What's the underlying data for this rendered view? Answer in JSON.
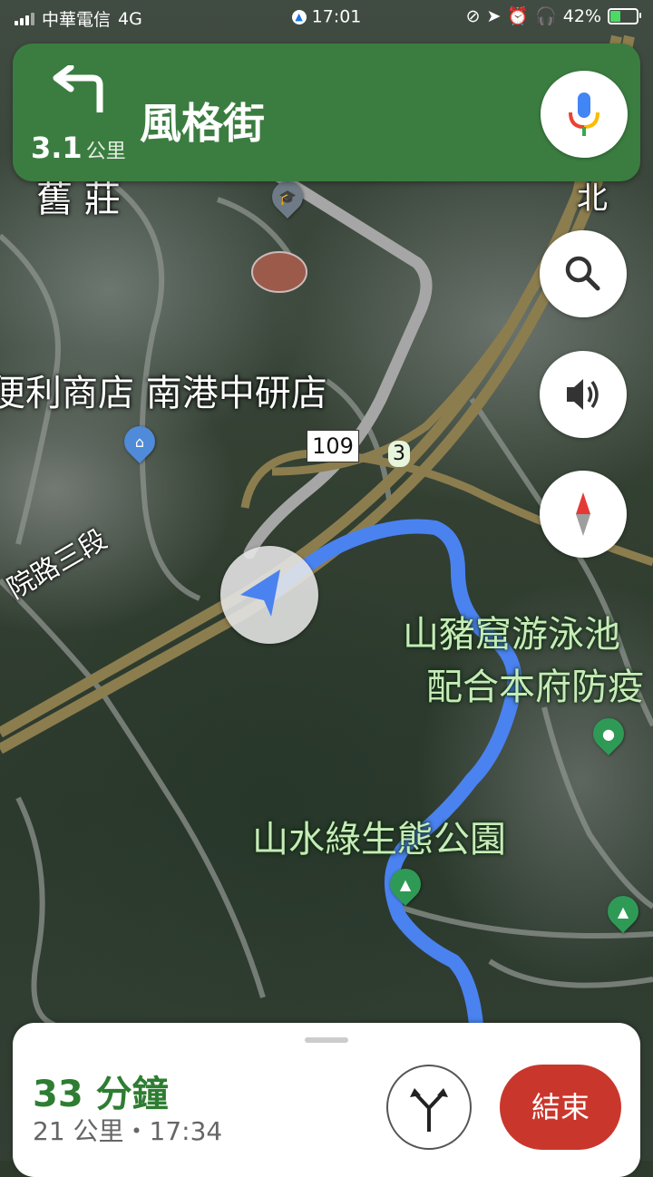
{
  "status_bar": {
    "carrier": "中華電信",
    "network": "4G",
    "time": "17:01",
    "battery_percent": "42%",
    "battery_level": 0.42
  },
  "direction": {
    "turn_icon": "turn-left-arrow",
    "distance_value": "3.1",
    "distance_unit": "公里",
    "street": "風格街"
  },
  "map": {
    "labels": {
      "top_left_partial": "舊 莊",
      "store": "便利商店 南港中研店",
      "road_name": "院路三段",
      "route_number": "109",
      "route_badge": "3",
      "pool_line1": "山豬窟游泳池",
      "pool_line2": "配合本府防疫",
      "park": "山水綠生態公園",
      "top_right_partial": "北"
    },
    "colors": {
      "route": "#4a82f0",
      "road": "#9a9a9a",
      "highway": "#8c7d4e"
    }
  },
  "controls": {
    "mic": "mic-icon",
    "search": "search-icon",
    "sound": "speaker-icon",
    "compass": "compass-icon"
  },
  "trip": {
    "eta_duration": "33 分鐘",
    "distance": "21 公里",
    "separator": "・",
    "arrival_time": "17:34",
    "end_label": "結束",
    "alt_routes_icon": "alt-routes-icon"
  },
  "colors": {
    "direction_bg": "#3b7d40",
    "eta_green": "#2e7d32",
    "end_red": "#c9372c",
    "location_blue": "#4a82f0"
  }
}
